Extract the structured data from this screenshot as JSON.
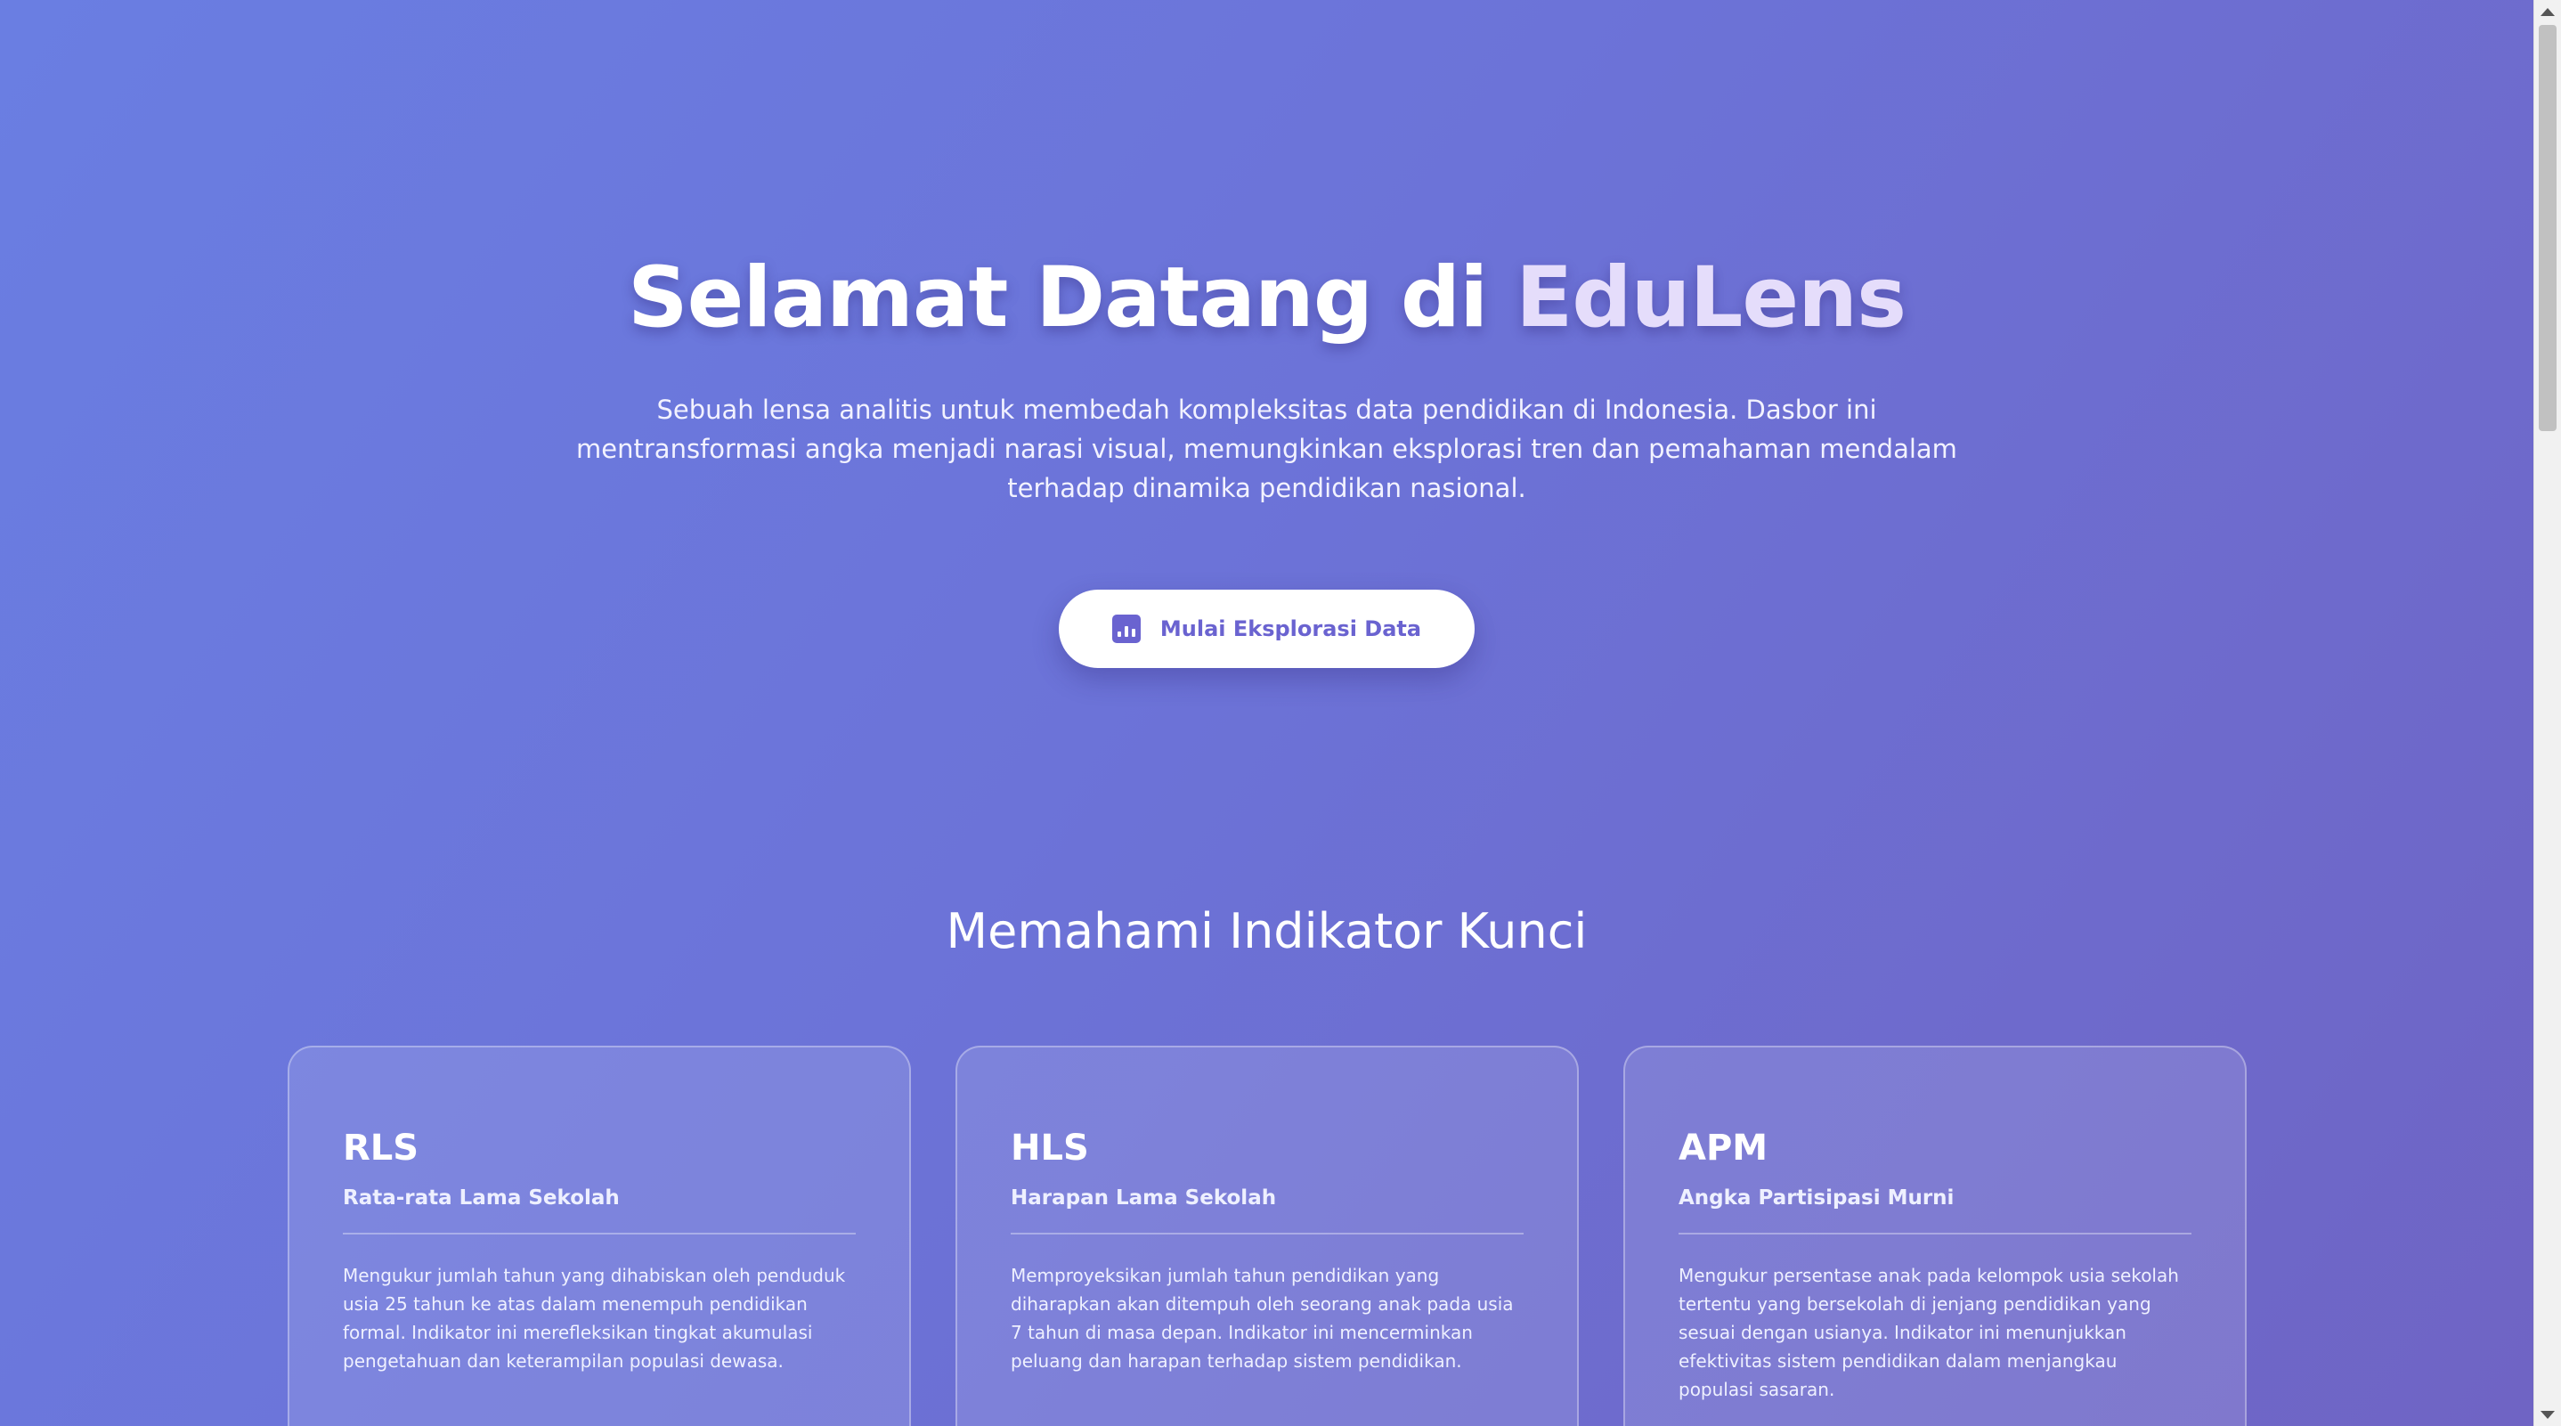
{
  "hero": {
    "title_prefix": "Selamat Datang di ",
    "title_brand": "EduLens",
    "description": "Sebuah lensa analitis untuk membedah kompleksitas data pendidikan di Indonesia. Dasbor ini mentransformasi angka menjadi narasi visual, memungkinkan eksplorasi tren dan pemahaman mendalam terhadap dinamika pendidikan nasional.",
    "cta_label": "Mulai Eksplorasi Data",
    "cta_icon": "bar-chart-icon"
  },
  "indicators": {
    "title": "Memahami Indikator Kunci",
    "cards": [
      {
        "code": "RLS",
        "name": "Rata-rata Lama Sekolah",
        "description": "Mengukur jumlah tahun yang dihabiskan oleh penduduk usia 25 tahun ke atas dalam menempuh pendidikan formal. Indikator ini merefleksikan tingkat akumulasi pengetahuan dan keterampilan populasi dewasa."
      },
      {
        "code": "HLS",
        "name": "Harapan Lama Sekolah",
        "description": "Memproyeksikan jumlah tahun pendidikan yang diharapkan akan ditempuh oleh seorang anak pada usia 7 tahun di masa depan. Indikator ini mencerminkan peluang dan harapan terhadap sistem pendidikan."
      },
      {
        "code": "APM",
        "name": "Angka Partisipasi Murni",
        "description": "Mengukur persentase anak pada kelompok usia sekolah tertentu yang bersekolah di jenjang pendidikan yang sesuai dengan usianya. Indikator ini menunjukkan efektivitas sistem pendidikan dalam menjangkau populasi sasaran."
      }
    ]
  },
  "colors": {
    "background_start": "#6a7ee2",
    "background_end": "#6f64c4",
    "brand_accent": "#e5ddfb",
    "button_text": "#6a63d0"
  }
}
